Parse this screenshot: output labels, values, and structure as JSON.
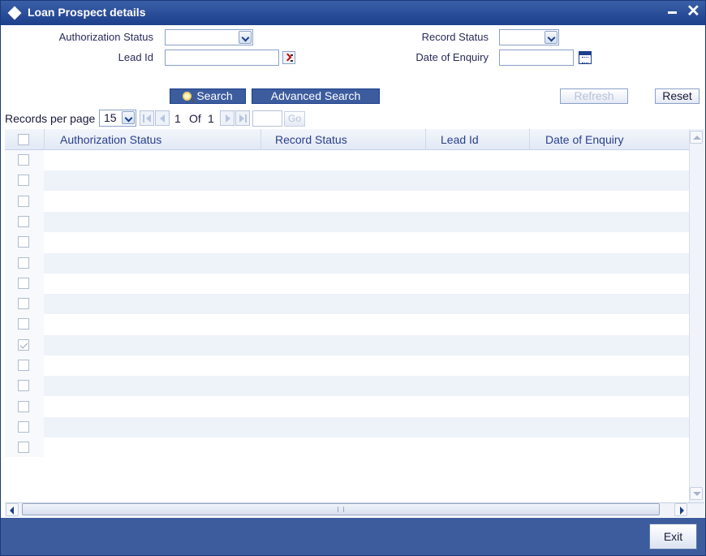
{
  "window": {
    "title": "Loan Prospect details"
  },
  "form": {
    "authorization_status_label": "Authorization Status",
    "authorization_status_value": "",
    "lead_id_label": "Lead Id",
    "lead_id_value": "",
    "record_status_label": "Record Status",
    "record_status_value": "",
    "date_of_enquiry_label": "Date of Enquiry",
    "date_of_enquiry_value": ""
  },
  "actions": {
    "search_label": "Search",
    "advanced_search_label": "Advanced Search",
    "refresh_label": "Refresh",
    "reset_label": "Reset"
  },
  "pager": {
    "records_per_page_label": "Records per page",
    "records_per_page_value": "15",
    "current_page": "1",
    "of_label": "Of",
    "total_pages": "1",
    "go_label": "Go"
  },
  "grid": {
    "columns": [
      "Authorization Status",
      "Record Status",
      "Lead Id",
      "Date of Enquiry"
    ],
    "row_count": 15,
    "checked_rows": [
      9
    ]
  },
  "footer": {
    "exit_label": "Exit"
  },
  "colors": {
    "titlebar": "#1d3f8c",
    "footer": "#3c5c9e",
    "accent": "#2a3f8c"
  },
  "icons": [
    "diamond-icon",
    "minimize-icon",
    "close-icon",
    "dropdown-arrow-icon",
    "lov-picker-icon",
    "calendar-icon",
    "search-icon",
    "first-page-icon",
    "previous-page-icon",
    "next-page-icon",
    "last-page-icon",
    "scroll-up-icon",
    "scroll-down-icon",
    "scroll-left-icon",
    "scroll-right-icon"
  ]
}
